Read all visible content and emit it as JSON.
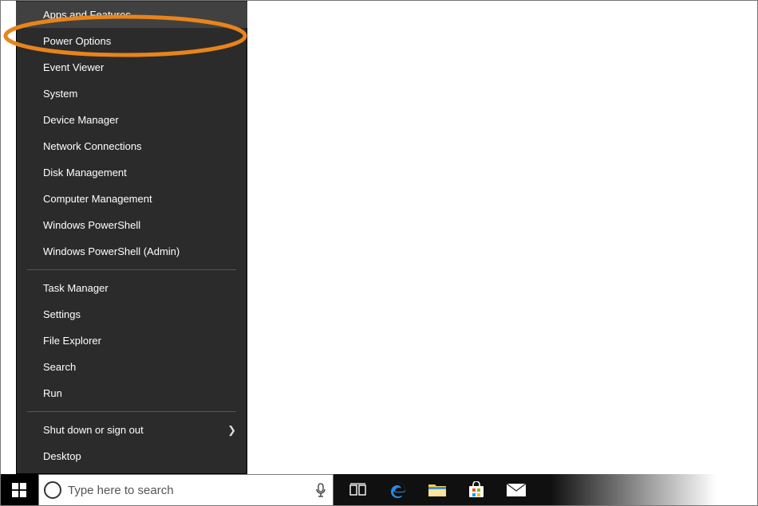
{
  "menu": {
    "groups": [
      [
        {
          "label": "Apps and Features",
          "hover": true
        },
        {
          "label": "Power Options"
        },
        {
          "label": "Event Viewer"
        },
        {
          "label": "System"
        },
        {
          "label": "Device Manager"
        },
        {
          "label": "Network Connections"
        },
        {
          "label": "Disk Management"
        },
        {
          "label": "Computer Management"
        },
        {
          "label": "Windows PowerShell"
        },
        {
          "label": "Windows PowerShell (Admin)"
        }
      ],
      [
        {
          "label": "Task Manager"
        },
        {
          "label": "Settings"
        },
        {
          "label": "File Explorer"
        },
        {
          "label": "Search"
        },
        {
          "label": "Run"
        }
      ],
      [
        {
          "label": "Shut down or sign out",
          "submenu": true
        },
        {
          "label": "Desktop"
        }
      ]
    ]
  },
  "taskbar": {
    "search_placeholder": "Type here to search",
    "icons": [
      "task-view",
      "edge",
      "file-explorer",
      "store",
      "mail"
    ]
  },
  "annotation": {
    "highlights": "Apps and Features",
    "color": "#e8841a"
  }
}
